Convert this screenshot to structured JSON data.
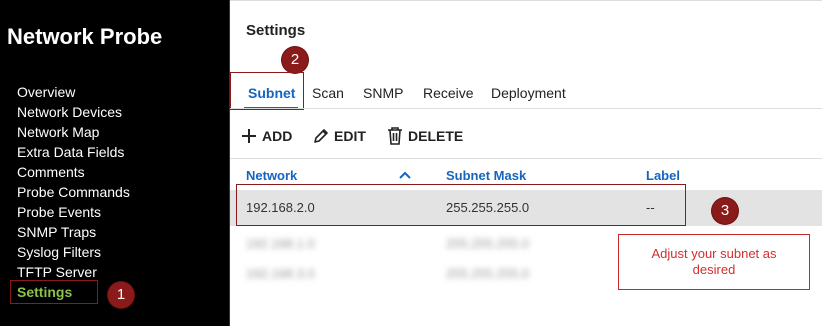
{
  "app": {
    "title": "Network Probe"
  },
  "sidebar": {
    "items": [
      {
        "label": "Overview"
      },
      {
        "label": "Network Devices"
      },
      {
        "label": "Network Map"
      },
      {
        "label": "Extra Data Fields"
      },
      {
        "label": "Comments"
      },
      {
        "label": "Probe Commands"
      },
      {
        "label": "Probe Events"
      },
      {
        "label": "SNMP Traps"
      },
      {
        "label": "Syslog Filters"
      },
      {
        "label": "TFTP Server"
      },
      {
        "label": "Settings",
        "active": true
      }
    ]
  },
  "main": {
    "title": "Settings",
    "tabs": [
      {
        "label": "Subnet",
        "active": true
      },
      {
        "label": "Scan"
      },
      {
        "label": "SNMP"
      },
      {
        "label": "Receive"
      },
      {
        "label": "Deployment"
      }
    ],
    "toolbar": {
      "add_label": "ADD",
      "edit_label": "EDIT",
      "delete_label": "DELETE"
    },
    "table": {
      "columns": [
        "Network",
        "Subnet Mask",
        "Label"
      ],
      "rows": [
        {
          "network": "192.168.2.0",
          "mask": "255.255.255.0",
          "label": "--"
        },
        {
          "network": "192.168.1.0",
          "mask": "255.255.255.0",
          "label": ""
        },
        {
          "network": "192.168.3.0",
          "mask": "255.255.255.0",
          "label": ""
        }
      ]
    }
  },
  "annotations": {
    "callout_1": "1",
    "callout_2": "2",
    "callout_3": "3",
    "note": "Adjust your subnet as desired"
  },
  "colors": {
    "sidebar_bg": "#000000",
    "active_nav": "#8bc34a",
    "accent_blue": "#1565c0",
    "annotation_red": "#8b1a1a",
    "note_text": "#d32f2f",
    "selected_row_bg": "#e3e3e3"
  },
  "icons": {
    "add": "plus-icon",
    "edit": "pencil-icon",
    "delete": "trash-icon",
    "sort": "chevron-up-icon"
  }
}
